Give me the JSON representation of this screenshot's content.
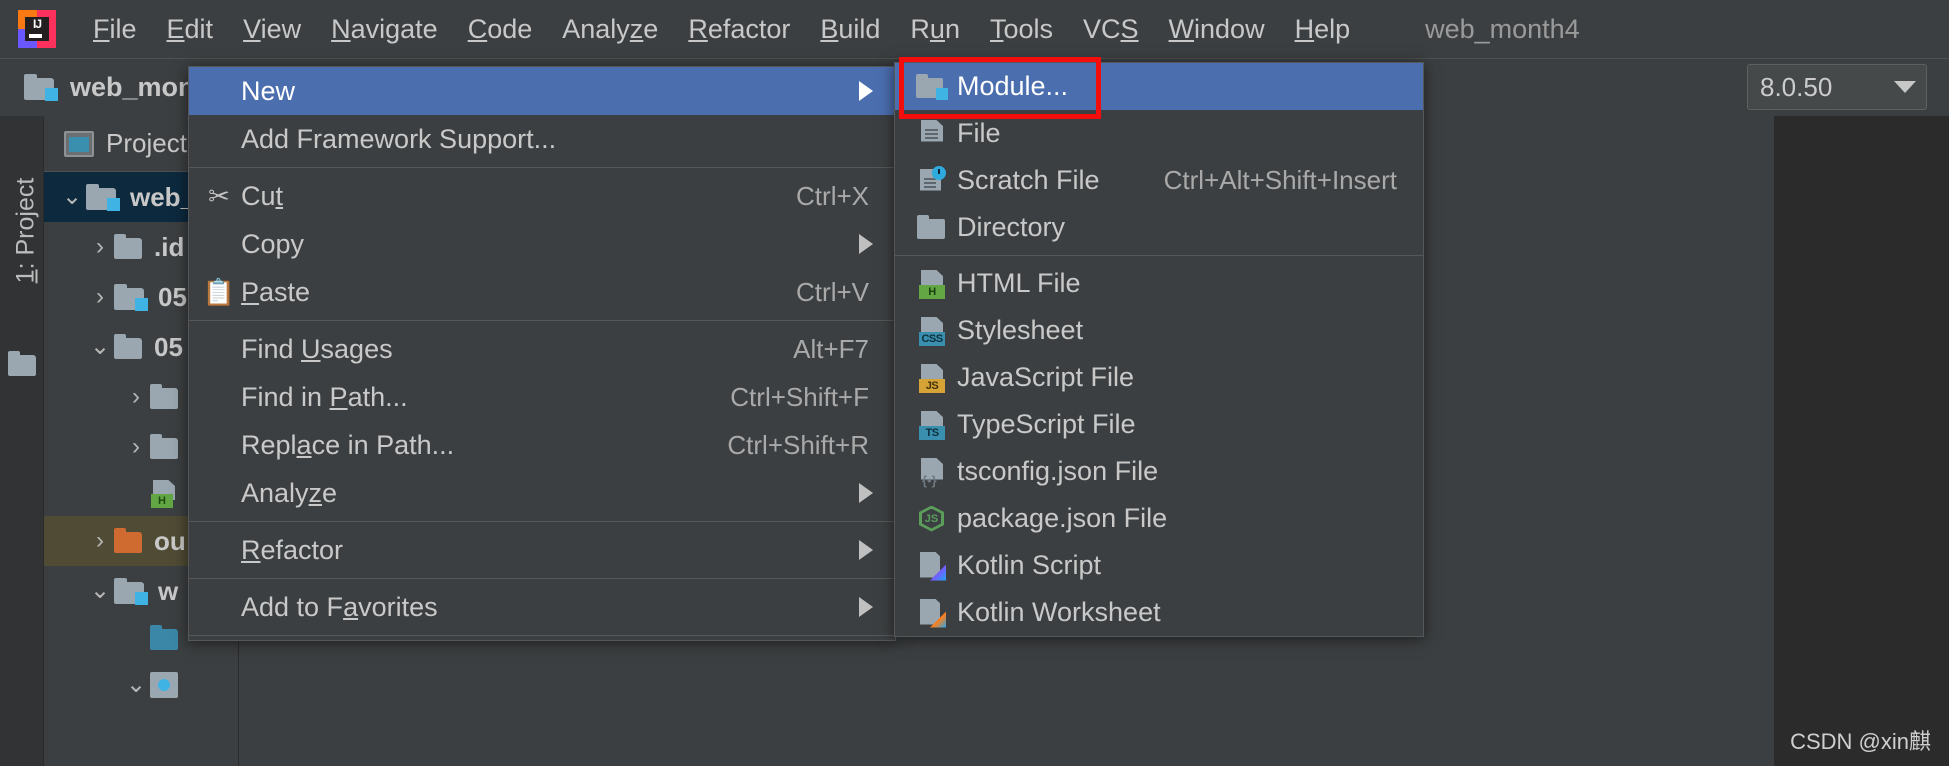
{
  "app": {
    "logo_text": "IJ",
    "project_title": "web_month4",
    "watermark": "CSDN @xin麒"
  },
  "menubar": {
    "items": [
      {
        "label": "File",
        "mnemonic": "F"
      },
      {
        "label": "Edit",
        "mnemonic": "E"
      },
      {
        "label": "View",
        "mnemonic": "V"
      },
      {
        "label": "Navigate",
        "mnemonic": "N"
      },
      {
        "label": "Code",
        "mnemonic": "C"
      },
      {
        "label": "Analyze",
        "mnemonic": "z"
      },
      {
        "label": "Refactor",
        "mnemonic": "R"
      },
      {
        "label": "Build",
        "mnemonic": "B"
      },
      {
        "label": "Run",
        "mnemonic": "u"
      },
      {
        "label": "Tools",
        "mnemonic": "T"
      },
      {
        "label": "VCS",
        "mnemonic": "S"
      },
      {
        "label": "Window",
        "mnemonic": "W"
      },
      {
        "label": "Help",
        "mnemonic": "H"
      }
    ]
  },
  "toolbar": {
    "breadcrumb_label": "web_mont",
    "jdk_value": "8.0.50"
  },
  "left_strip": {
    "tab_label": "1: Project",
    "tab_mnemonic": "1"
  },
  "project_panel": {
    "header_label": "Project",
    "tree": [
      {
        "name": "web_",
        "twisty": "v",
        "icon": "folder-module",
        "indent": 0,
        "state": "selected"
      },
      {
        "name": ".id",
        "twisty": ">",
        "icon": "folder",
        "indent": 1,
        "state": "normal"
      },
      {
        "name": "05",
        "twisty": ">",
        "icon": "folder-module",
        "indent": 1,
        "state": "normal"
      },
      {
        "name": "05",
        "twisty": "v",
        "icon": "folder",
        "indent": 1,
        "state": "normal"
      },
      {
        "name": "",
        "twisty": ">",
        "icon": "folder",
        "indent": 2,
        "state": "normal"
      },
      {
        "name": "",
        "twisty": ">",
        "icon": "folder",
        "indent": 2,
        "state": "normal"
      },
      {
        "name": "",
        "twisty": "",
        "icon": "html-file",
        "indent": 2,
        "state": "normal"
      },
      {
        "name": "ou",
        "twisty": ">",
        "icon": "folder-orange",
        "indent": 1,
        "state": "selected-folder"
      },
      {
        "name": "w",
        "twisty": "v",
        "icon": "folder-module",
        "indent": 1,
        "state": "normal"
      },
      {
        "name": "",
        "twisty": "",
        "icon": "folder-teal",
        "indent": 2,
        "state": "normal"
      },
      {
        "name": "",
        "twisty": "v",
        "icon": "disc",
        "indent": 2,
        "state": "normal"
      }
    ]
  },
  "context_menu": {
    "items": [
      {
        "label": "New",
        "mnemonic": "",
        "accel": "",
        "icon": "",
        "arrow": true,
        "selected": true,
        "separator_after": false
      },
      {
        "label": "Add Framework Support...",
        "mnemonic": "",
        "accel": "",
        "icon": "",
        "arrow": false,
        "selected": false,
        "separator_after": true
      },
      {
        "label": "Cut",
        "mnemonic": "t",
        "accel": "Ctrl+X",
        "icon": "scissors-icon",
        "arrow": false,
        "selected": false,
        "separator_after": false
      },
      {
        "label": "Copy",
        "mnemonic": "",
        "accel": "",
        "icon": "",
        "arrow": true,
        "selected": false,
        "separator_after": false
      },
      {
        "label": "Paste",
        "mnemonic": "P",
        "accel": "Ctrl+V",
        "icon": "clipboard-icon",
        "arrow": false,
        "selected": false,
        "separator_after": true
      },
      {
        "label": "Find Usages",
        "mnemonic": "U",
        "accel": "Alt+F7",
        "icon": "",
        "arrow": false,
        "selected": false,
        "separator_after": false
      },
      {
        "label": "Find in Path...",
        "mnemonic": "P",
        "accel": "Ctrl+Shift+F",
        "icon": "",
        "arrow": false,
        "selected": false,
        "separator_after": false
      },
      {
        "label": "Replace in Path...",
        "mnemonic": "a",
        "accel": "Ctrl+Shift+R",
        "icon": "",
        "arrow": false,
        "selected": false,
        "separator_after": false
      },
      {
        "label": "Analyze",
        "mnemonic": "z",
        "accel": "",
        "icon": "",
        "arrow": true,
        "selected": false,
        "separator_after": true
      },
      {
        "label": "Refactor",
        "mnemonic": "R",
        "accel": "",
        "icon": "",
        "arrow": true,
        "selected": false,
        "separator_after": true
      },
      {
        "label": "Add to Favorites",
        "mnemonic": "a",
        "accel": "",
        "icon": "",
        "arrow": true,
        "selected": false,
        "separator_after": true
      }
    ]
  },
  "submenu": {
    "items": [
      {
        "label": "Module...",
        "accel": "",
        "icon": "module-icon",
        "selected": true,
        "separator_after": false
      },
      {
        "label": "File",
        "accel": "",
        "icon": "file-icon",
        "selected": false,
        "separator_after": false
      },
      {
        "label": "Scratch File",
        "accel": "Ctrl+Alt+Shift+Insert",
        "icon": "scratch-file-icon",
        "selected": false,
        "separator_after": false
      },
      {
        "label": "Directory",
        "accel": "",
        "icon": "directory-icon",
        "selected": false,
        "separator_after": true
      },
      {
        "label": "HTML File",
        "accel": "",
        "icon": "html-file-icon",
        "selected": false,
        "separator_after": false
      },
      {
        "label": "Stylesheet",
        "accel": "",
        "icon": "css-file-icon",
        "selected": false,
        "separator_after": false
      },
      {
        "label": "JavaScript File",
        "accel": "",
        "icon": "js-file-icon",
        "selected": false,
        "separator_after": false
      },
      {
        "label": "TypeScript File",
        "accel": "",
        "icon": "ts-file-icon",
        "selected": false,
        "separator_after": false
      },
      {
        "label": "tsconfig.json File",
        "accel": "",
        "icon": "tsconfig-file-icon",
        "selected": false,
        "separator_after": false
      },
      {
        "label": "package.json File",
        "accel": "",
        "icon": "package-json-icon",
        "selected": false,
        "separator_after": false
      },
      {
        "label": "Kotlin Script",
        "accel": "",
        "icon": "kotlin-script-icon",
        "selected": false,
        "separator_after": false
      },
      {
        "label": "Kotlin Worksheet",
        "accel": "",
        "icon": "kotlin-worksheet-icon",
        "selected": false,
        "separator_after": false
      }
    ]
  },
  "colors": {
    "menu_selection": "#4b6eaf",
    "highlight_box": "#f40d0d",
    "panel_bg": "#3c3f41",
    "tree_selection": "#0d293e",
    "tree_folder_selection": "#4f4b34"
  }
}
